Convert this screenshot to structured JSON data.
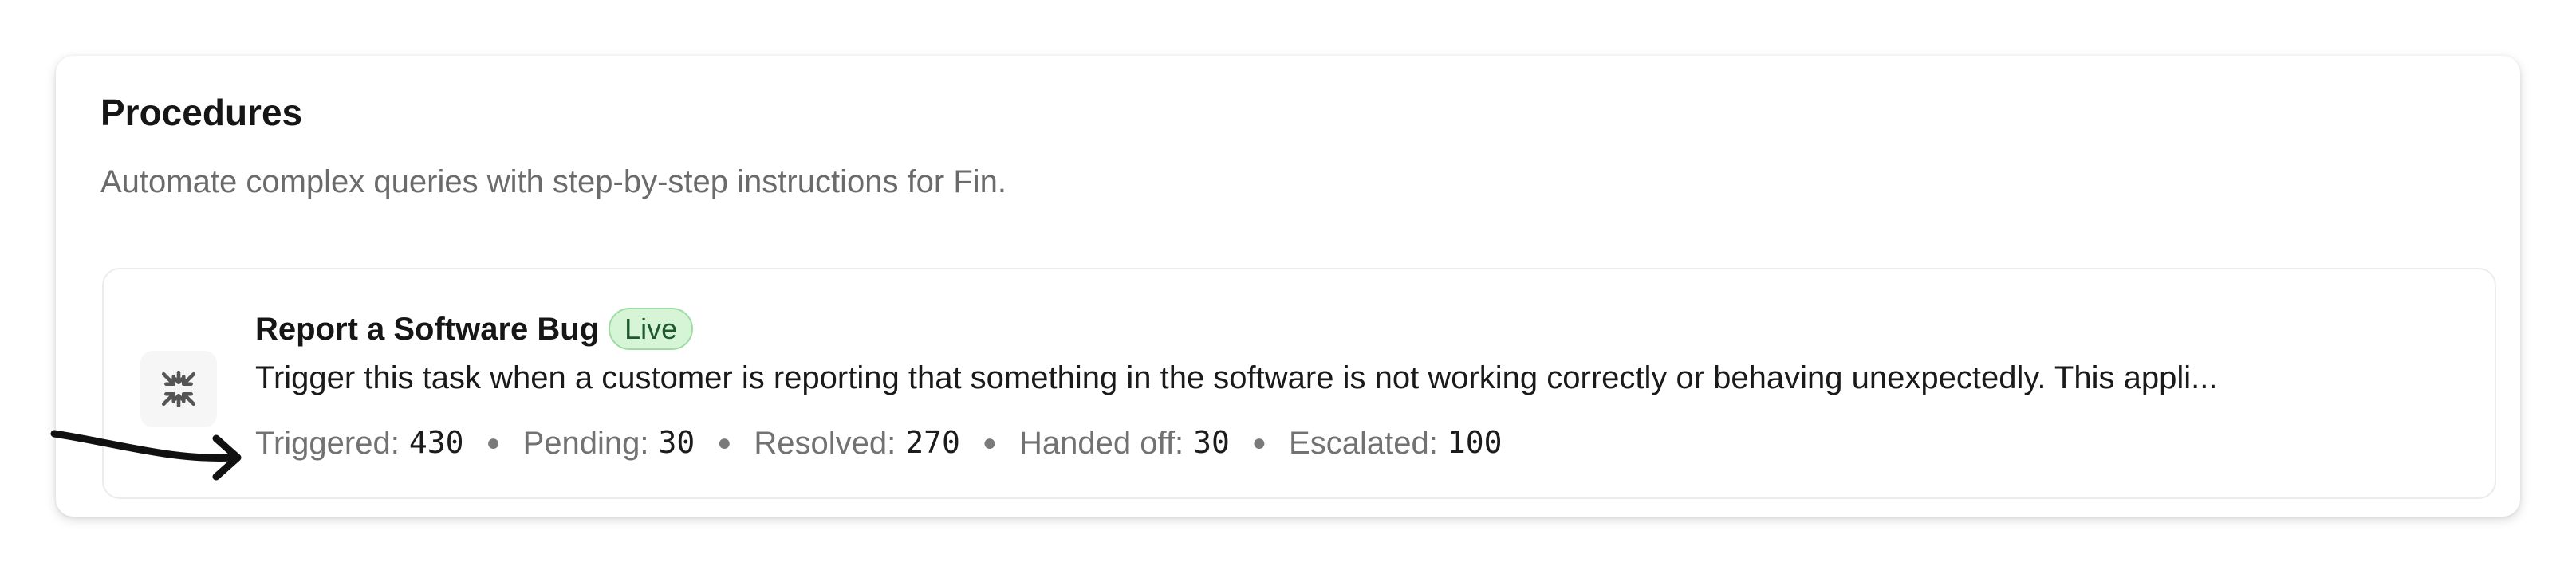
{
  "panel": {
    "title": "Procedures",
    "subtitle": "Automate complex queries with step-by-step instructions for Fin."
  },
  "procedure": {
    "icon": "compress-arrows-icon",
    "title": "Report a Software Bug",
    "status": "Live",
    "description": "Trigger this task when a customer is reporting that something in the software is not working correctly or behaving unexpectedly. This appli...",
    "stats": [
      {
        "label": "Triggered:",
        "value": "430"
      },
      {
        "label": "Pending:",
        "value": "30"
      },
      {
        "label": "Resolved:",
        "value": "270"
      },
      {
        "label": "Handed off:",
        "value": "30"
      },
      {
        "label": "Escalated:",
        "value": "100"
      }
    ]
  },
  "colors": {
    "live_badge_bg": "#d6f5d7",
    "live_badge_border": "#9fdca3",
    "live_badge_text": "#1f5a2e"
  }
}
